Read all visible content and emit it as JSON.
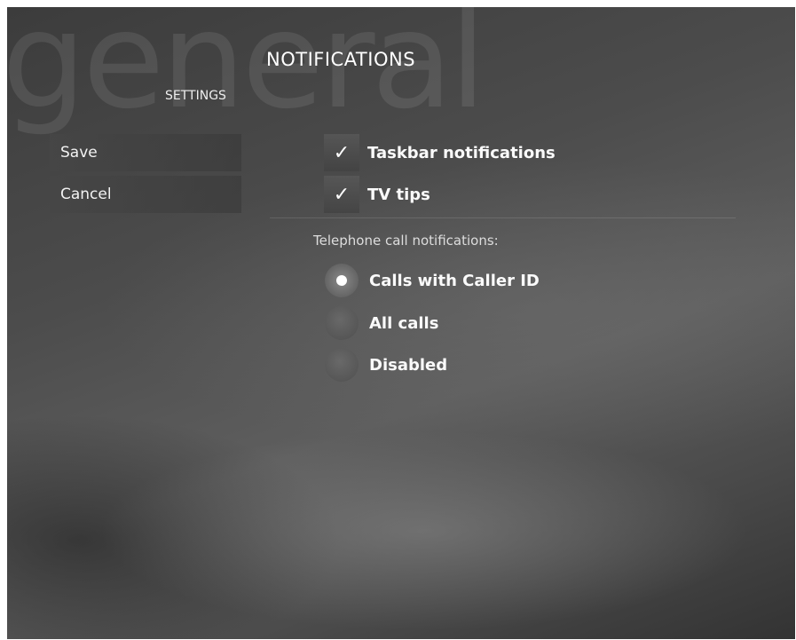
{
  "watermark": "general",
  "header": {
    "title": "NOTIFICATIONS",
    "subtitle": "SETTINGS"
  },
  "sidebar": {
    "save_label": "Save",
    "cancel_label": "Cancel"
  },
  "checkboxes": [
    {
      "label": "Taskbar notifications",
      "checked": true,
      "mark": "✓"
    },
    {
      "label": "TV tips",
      "checked": true,
      "mark": "✓"
    }
  ],
  "telephone": {
    "group_label": "Telephone call notifications:",
    "options": [
      {
        "label": "Calls with Caller ID",
        "selected": true
      },
      {
        "label": "All calls",
        "selected": false
      },
      {
        "label": "Disabled",
        "selected": false
      }
    ]
  },
  "icons": {
    "checkmark": "check-icon",
    "radio_selected": "radio-selected-icon",
    "radio_unselected": "radio-unselected-icon"
  }
}
